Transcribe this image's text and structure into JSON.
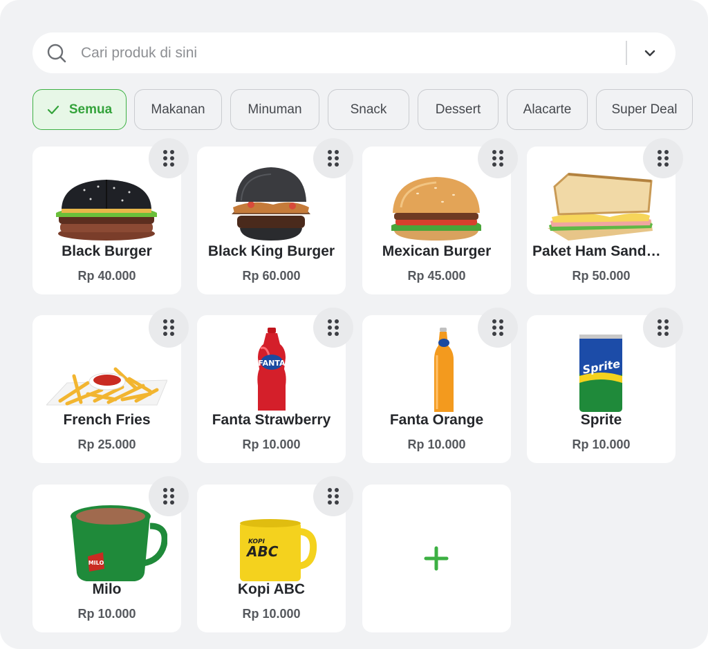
{
  "search": {
    "placeholder": "Cari produk di sini",
    "icon": "search-icon",
    "dropdown_icon": "chevron-down-icon"
  },
  "categories": [
    {
      "label": "Semua",
      "active": true
    },
    {
      "label": "Makanan",
      "active": false
    },
    {
      "label": "Minuman",
      "active": false
    },
    {
      "label": "Snack",
      "active": false
    },
    {
      "label": "Dessert",
      "active": false
    },
    {
      "label": "Alacarte",
      "active": false
    },
    {
      "label": "Super Deal",
      "active": false
    }
  ],
  "products": [
    {
      "name": "Black Burger",
      "price": "Rp 40.000",
      "image": "black-burger-image"
    },
    {
      "name": "Black King Burger",
      "price": "Rp 60.000",
      "image": "black-king-burger-image"
    },
    {
      "name": "Mexican Burger",
      "price": "Rp 45.000",
      "image": "mexican-burger-image"
    },
    {
      "name": "Paket Ham Sandwich",
      "price": "Rp 50.000",
      "image": "ham-sandwich-image"
    },
    {
      "name": "French Fries",
      "price": "Rp 25.000",
      "image": "french-fries-image"
    },
    {
      "name": "Fanta Strawberry",
      "price": "Rp 10.000",
      "image": "fanta-strawberry-bottle-image"
    },
    {
      "name": "Fanta Orange",
      "price": "Rp 10.000",
      "image": "fanta-orange-bottle-image"
    },
    {
      "name": "Sprite",
      "price": "Rp 10.000",
      "image": "sprite-can-image"
    },
    {
      "name": "Milo",
      "price": "Rp 10.000",
      "image": "milo-mug-image"
    },
    {
      "name": "Kopi ABC",
      "price": "Rp 10.000",
      "image": "kopi-abc-mug-image"
    }
  ],
  "add_product_icon": "plus-icon",
  "drag_handle_icon": "drag-handle-icon",
  "colors": {
    "accent": "#3cb043",
    "active_chip_bg": "#e7f7e7",
    "background": "#f1f2f4",
    "card": "#ffffff"
  },
  "logos": {
    "fanta": "FANTA",
    "sprite": "Sprite",
    "milo": "MILO",
    "kopi": "KOPI",
    "abc": "ABC"
  }
}
